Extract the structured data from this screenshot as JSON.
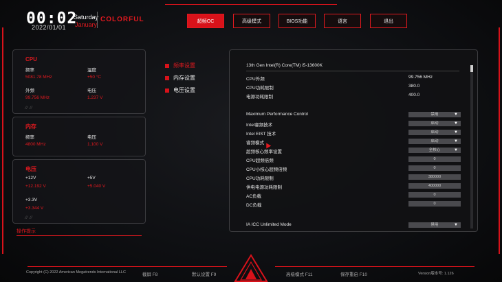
{
  "header": {
    "time": "00:02",
    "date": "2022/01/01",
    "day": "Saturday",
    "month": "January",
    "brand": "COLORFUL"
  },
  "tabs": [
    "超频OC",
    "高级模式",
    "BIOS功能",
    "语言",
    "退出"
  ],
  "cpu_card": {
    "title": "CPU",
    "freq_label": "频率",
    "freq_value": "5081.78 MHz",
    "temp_label": "温度",
    "temp_value": "+50 °C",
    "bclk_label": "外频",
    "bclk_value": "99.756 MHz",
    "volt_label": "电压",
    "volt_value": "1.237 V"
  },
  "mem_card": {
    "title": "内存",
    "freq_label": "频率",
    "freq_value": "4800 MHz",
    "volt_label": "电压",
    "volt_value": "1.100 V"
  },
  "volt_card": {
    "title": "电压",
    "v12_label": "+12V",
    "v12_value": "+12.192 V",
    "v5_label": "+5V",
    "v5_value": "+5.040 V",
    "v33_label": "+3.3V",
    "v33_value": "+3.344 V"
  },
  "hint": "操作提示",
  "menu": [
    "频率设置",
    "内存设置",
    "电压设置"
  ],
  "panel": {
    "cpu_name": "13th Gen Intel(R) Core(TM) i5-13600K",
    "info": [
      [
        "CPU外频",
        "99.756 MHz"
      ],
      [
        "CPU功耗限制",
        "380.0"
      ],
      [
        "电源功耗限制",
        "400.0"
      ]
    ],
    "settings": [
      [
        "Maximum Performance Control",
        "禁用",
        true
      ],
      [
        "Intel睿频技术",
        "启动",
        true
      ],
      [
        "Intel EIST 技术",
        "启动",
        true
      ],
      [
        "睿频模式",
        "启动",
        true
      ],
      [
        "超频核心频率设置",
        "全核心",
        true
      ],
      [
        "CPU超频倍频",
        "0",
        false
      ],
      [
        "CPU小核心超频倍频",
        "0",
        false
      ],
      [
        "CPU功耗限制",
        "380000",
        false
      ],
      [
        "供电电源功耗限制",
        "400000",
        false
      ],
      [
        "AC负载",
        "0",
        false
      ],
      [
        "DC负载",
        "0",
        false
      ]
    ],
    "last": [
      "IA ICC Unlimited Mode",
      "禁用",
      true
    ]
  },
  "footer": {
    "copyright": "Copyright (C) 2022 American Megatrends International LLC",
    "f8": "截屏 F8",
    "f9": "默认设置 F9",
    "f11": "高级模式 F11",
    "f10": "保存重启 F10",
    "version": "Version版本号: 1.126"
  }
}
